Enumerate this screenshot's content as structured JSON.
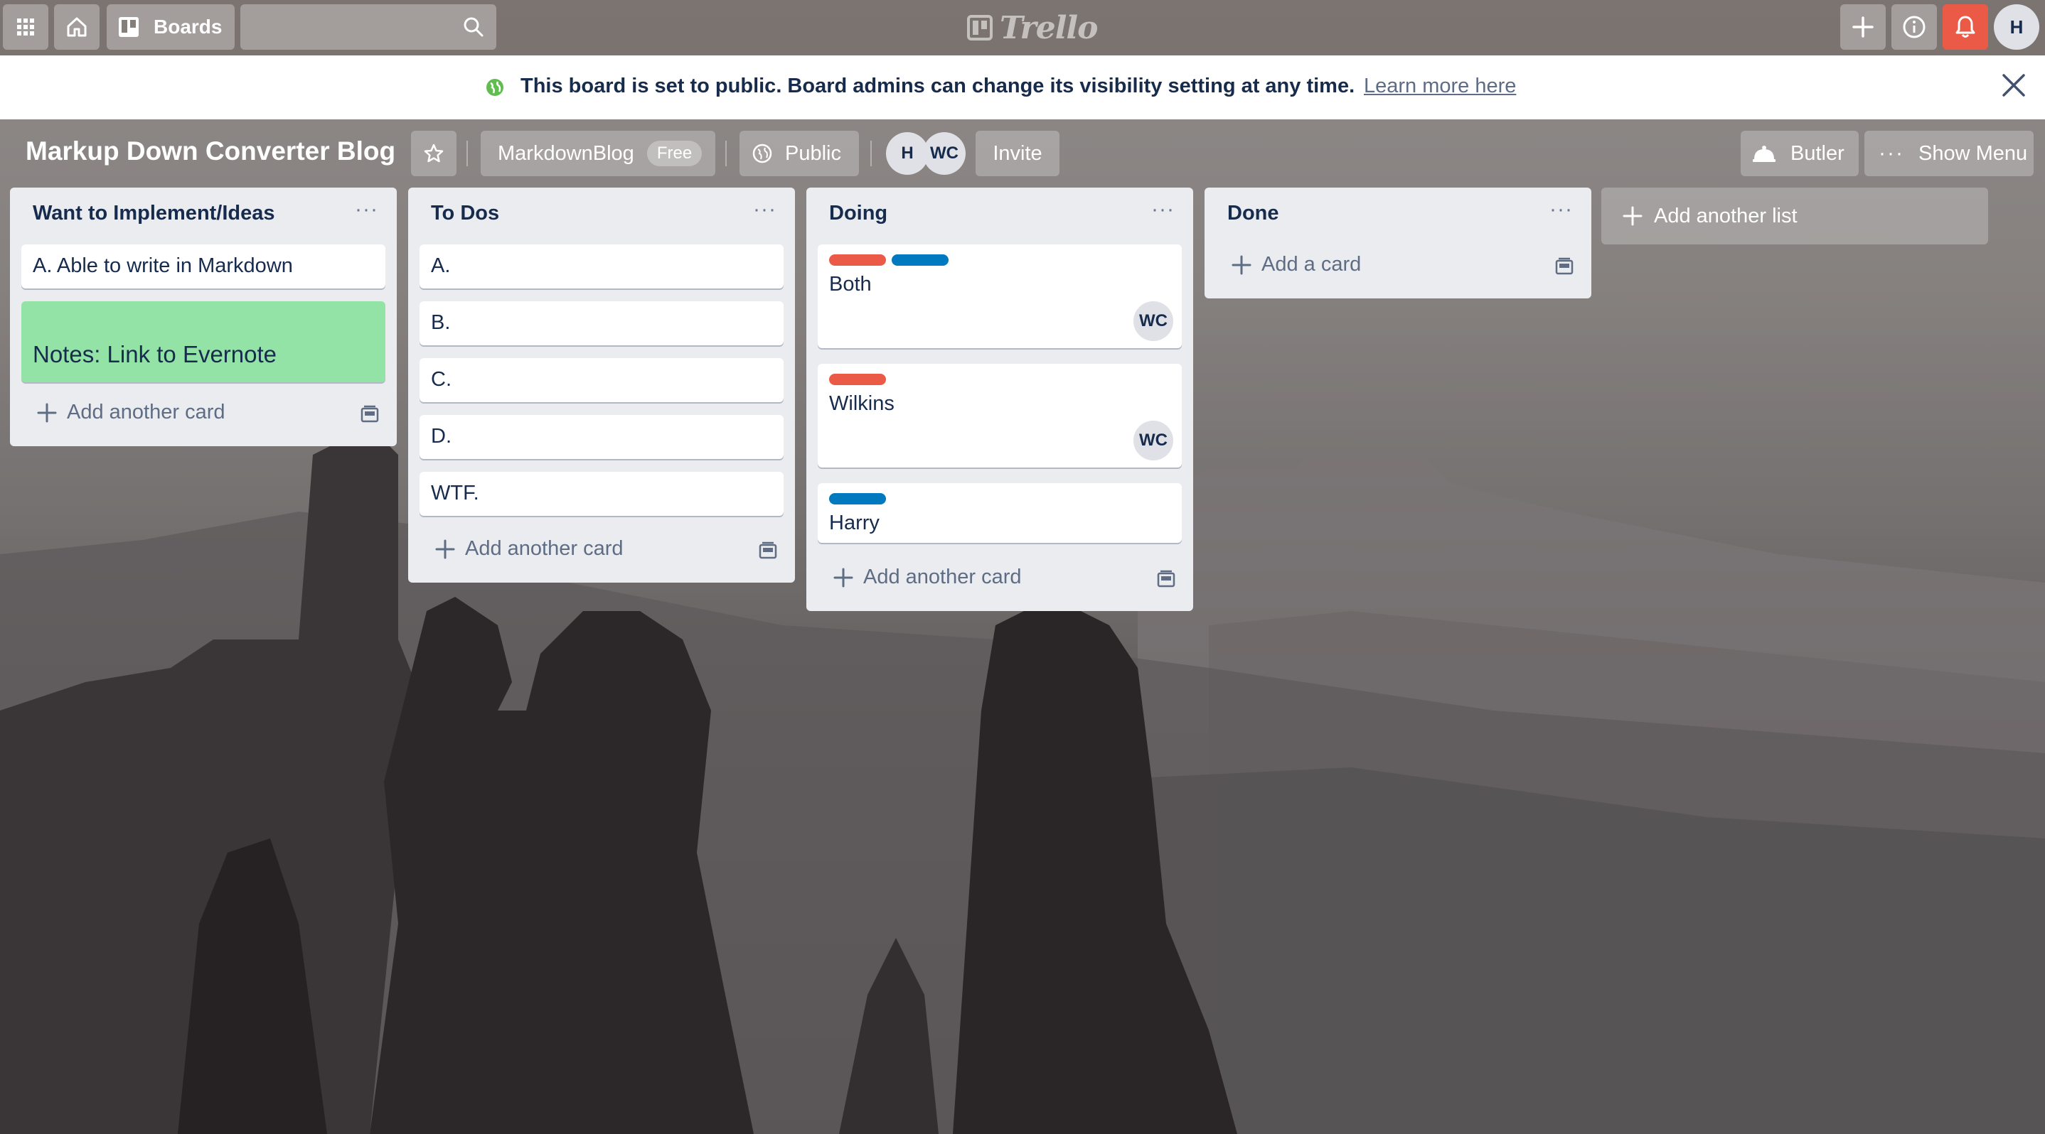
{
  "header": {
    "apps_icon": "grid-icon",
    "home_icon": "home-icon",
    "boards_label": "Boards",
    "search_placeholder": "",
    "logo_text": "Trello",
    "avatar_initial": "H"
  },
  "banner": {
    "message": "This board is set to public. Board admins can change its visibility setting at any time.",
    "link": "Learn more here"
  },
  "board": {
    "title": "Markup Down Converter Blog",
    "team_name": "MarkdownBlog",
    "team_badge": "Free",
    "visibility": "Public",
    "members": [
      "H",
      "WC"
    ],
    "invite_label": "Invite",
    "butler_label": "Butler",
    "show_menu_label": "Show Menu"
  },
  "lists": [
    {
      "title": "Want to Implement/Ideas",
      "cards": [
        {
          "text": "A. Able to write in Markdown"
        },
        {
          "text": "Notes: Link to Evernote",
          "cover": "#94e3a6"
        }
      ],
      "add_label": "Add another card"
    },
    {
      "title": "To Dos",
      "cards": [
        {
          "text": "A."
        },
        {
          "text": "B."
        },
        {
          "text": "C."
        },
        {
          "text": "D."
        },
        {
          "text": "WTF."
        }
      ],
      "add_label": "Add another card"
    },
    {
      "title": "Doing",
      "cards": [
        {
          "text": "Both",
          "labels": [
            "red",
            "blue"
          ],
          "member": "WC"
        },
        {
          "text": "Wilkins",
          "labels": [
            "red"
          ],
          "member": "WC"
        },
        {
          "text": "Harry",
          "labels": [
            "blue"
          ]
        }
      ],
      "add_label": "Add another card"
    },
    {
      "title": "Done",
      "cards": [],
      "add_label": "Add a card"
    }
  ],
  "add_list_label": "Add another list",
  "colors": {
    "label_red": "#eb5a46",
    "label_blue": "#0079bf",
    "notification_red": "#eb5a46",
    "list_bg": "#ebecf0"
  }
}
